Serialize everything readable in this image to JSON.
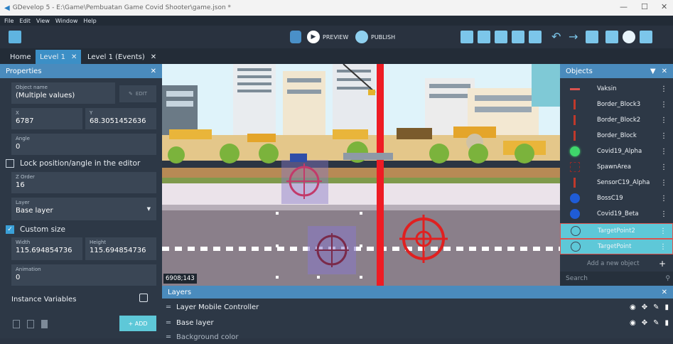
{
  "window": {
    "title": "GDevelop 5 - E:\\Game\\Pembuatan Game Covid Shooter\\game.json *"
  },
  "menu": [
    "File",
    "Edit",
    "View",
    "Window",
    "Help"
  ],
  "toolbar": {
    "preview_label": "PREVIEW",
    "publish_label": "PUBLISH"
  },
  "tabs": [
    {
      "label": "Home"
    },
    {
      "label": "Level 1"
    },
    {
      "label": "Level 1 (Events)"
    }
  ],
  "properties": {
    "title": "Properties",
    "object_name_label": "Object name",
    "object_name_value": "(Multiple values)",
    "edit_label": "EDIT",
    "x_label": "X",
    "x_value": "6787",
    "y_label": "Y",
    "y_value": "68.3051452636",
    "angle_label": "Angle",
    "angle_value": "0",
    "lock_label": "Lock position/angle in the editor",
    "z_label": "Z Order",
    "z_value": "16",
    "layer_label": "Layer",
    "layer_value": "Base layer",
    "custom_size_label": "Custom size",
    "width_label": "Width",
    "width_value": "115.694854736",
    "height_label": "Height",
    "height_value": "115.694854736",
    "animation_label": "Animation",
    "animation_value": "0",
    "instance_vars_label": "Instance Variables",
    "add_label": "+ ADD"
  },
  "canvas": {
    "coords": "6908;143"
  },
  "objects": {
    "title": "Objects",
    "items": [
      {
        "name": "Vaksin",
        "color": "#d9534f",
        "icon": "syringe-icon"
      },
      {
        "name": "Border_Block3",
        "color": "#c0392b",
        "icon": "border-icon"
      },
      {
        "name": "Border_Block2",
        "color": "#c0392b",
        "icon": "border-icon"
      },
      {
        "name": "Border_Block",
        "color": "#c0392b",
        "icon": "border-icon"
      },
      {
        "name": "Covid19_Alpha",
        "color": "#3fd66b",
        "icon": "virus-icon"
      },
      {
        "name": "SpawnArea",
        "color": "#8e2a2a",
        "icon": "spawn-icon"
      },
      {
        "name": "SensorC19_Alpha",
        "color": "#c0392b",
        "icon": "sensor-icon"
      },
      {
        "name": "BossC19",
        "color": "#1f5cd6",
        "icon": "virus-icon"
      },
      {
        "name": "Covid19_Beta",
        "color": "#1f5cd6",
        "icon": "virus-icon"
      },
      {
        "name": "TargetPoint2",
        "color": "#3a4a5a",
        "icon": "target-icon"
      },
      {
        "name": "TargetPoint",
        "color": "#3a4a5a",
        "icon": "target-icon"
      }
    ],
    "add_new_label": "Add a new object",
    "search_placeholder": "Search"
  },
  "layers": {
    "title": "Layers",
    "items": [
      {
        "name": "Layer Mobile Controller"
      },
      {
        "name": "Base layer"
      },
      {
        "name": "Background color"
      }
    ]
  },
  "colors": {
    "accent": "#3c8fc6",
    "selection": "#5ec8d8",
    "panel": "#2d3846"
  }
}
